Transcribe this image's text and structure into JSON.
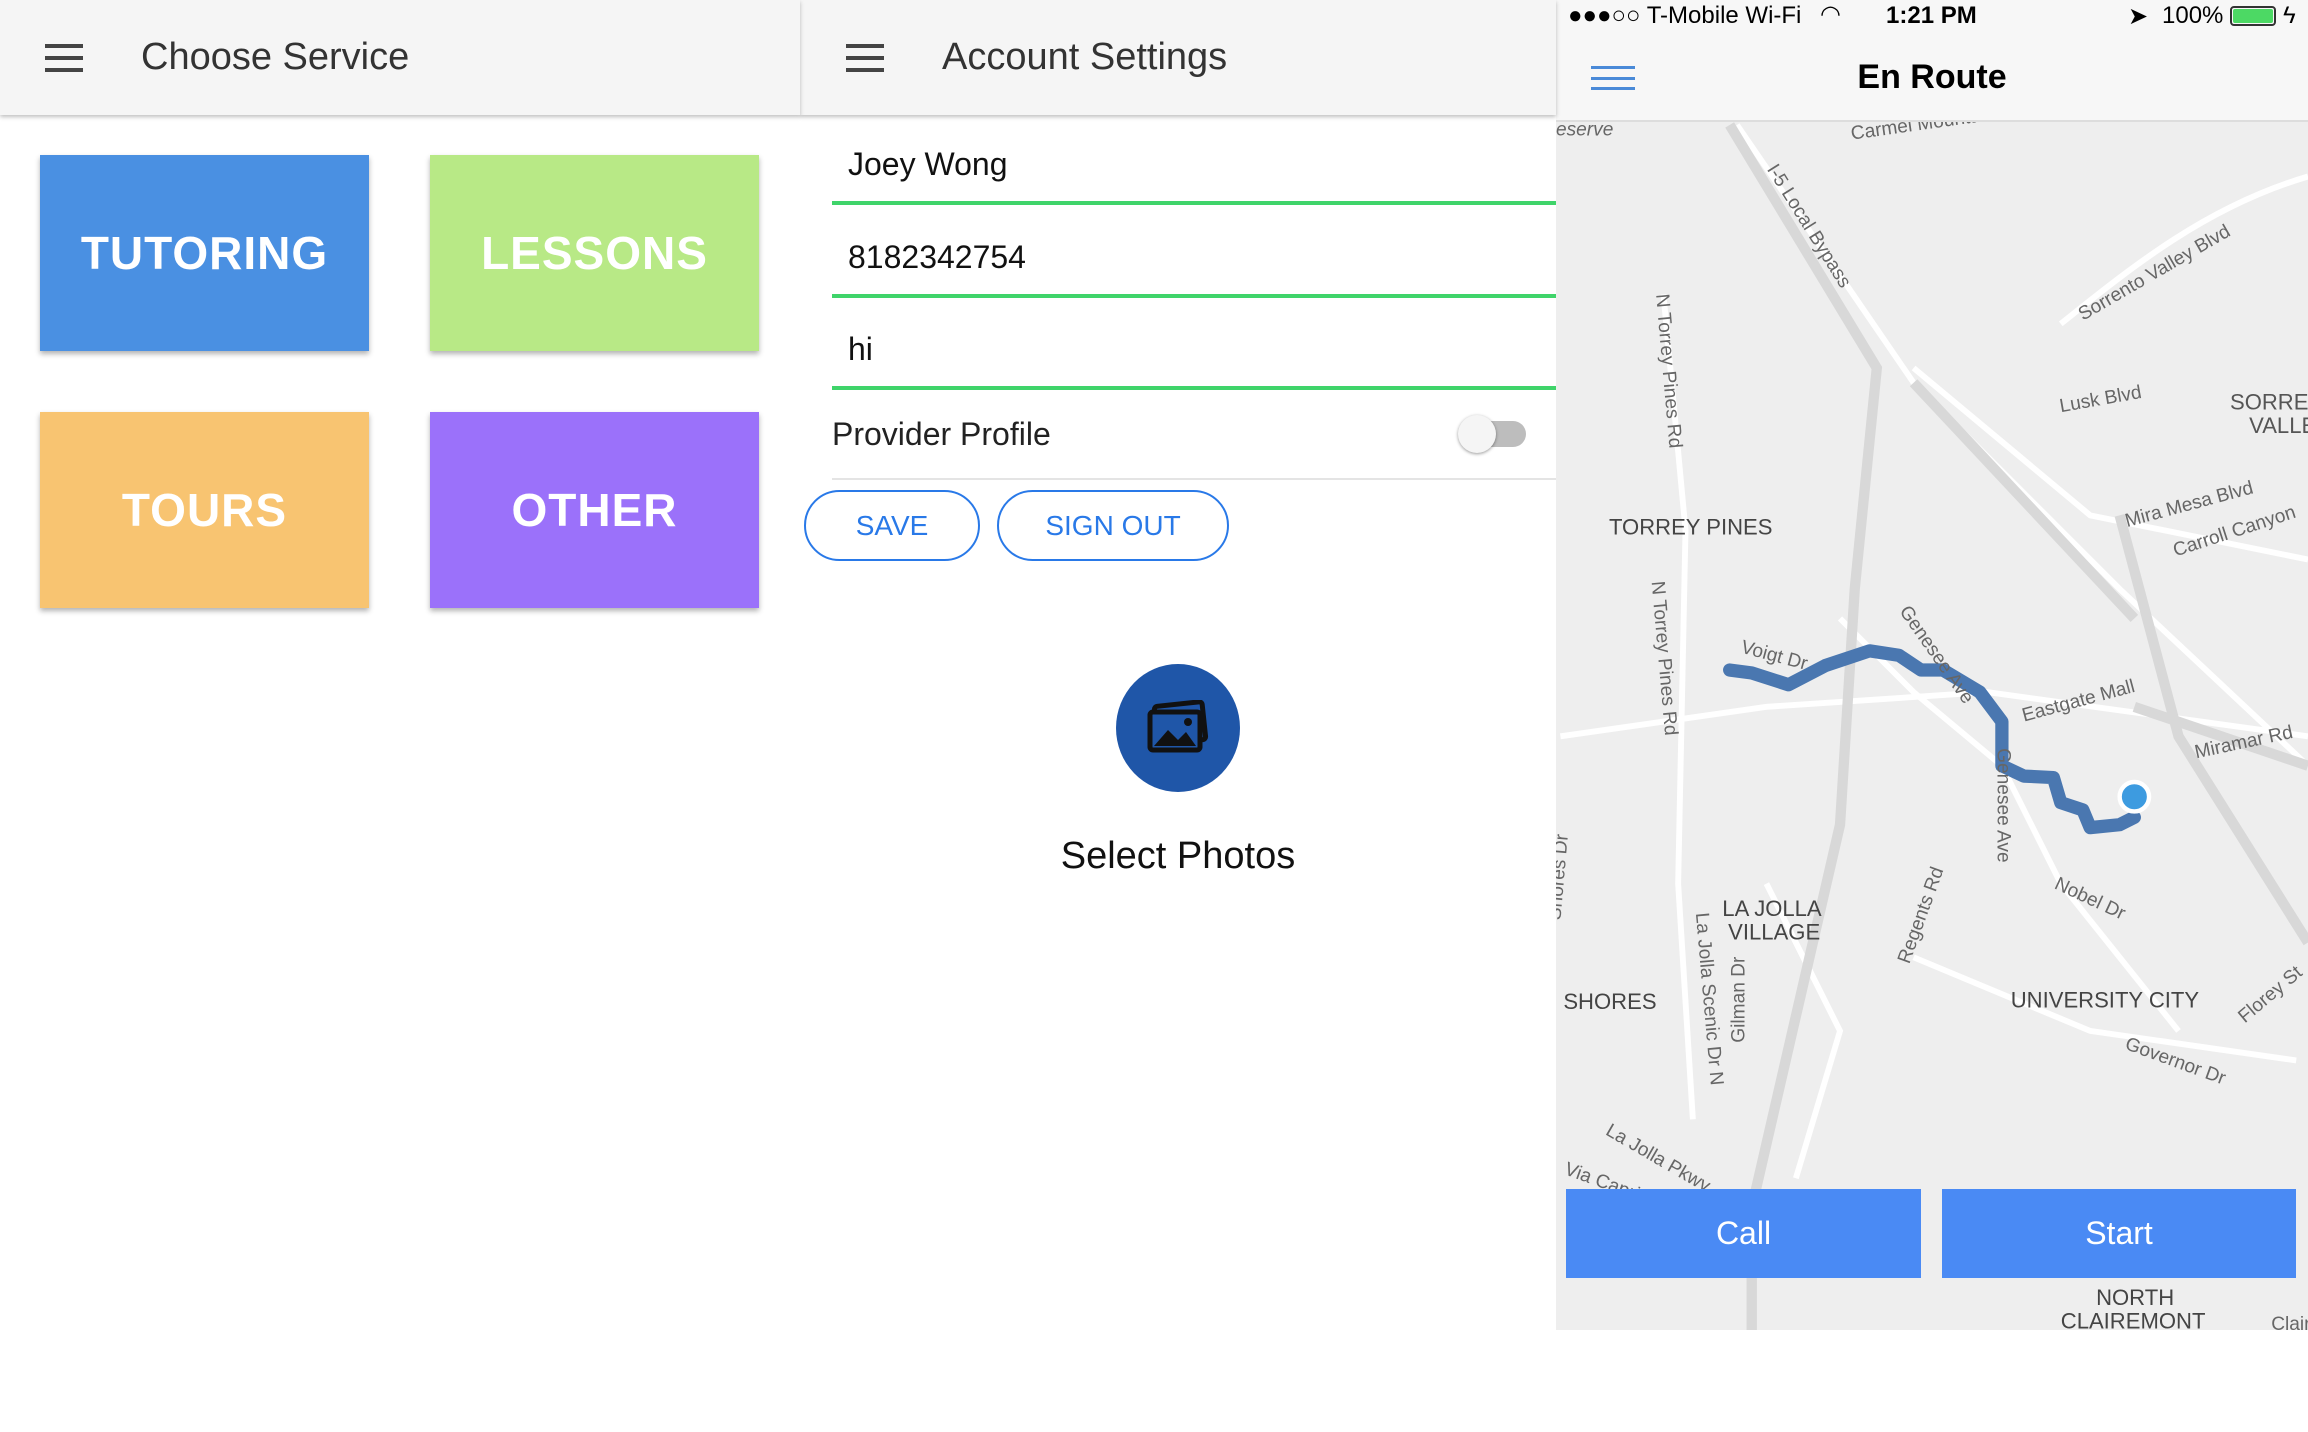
{
  "choose_service": {
    "title": "Choose Service",
    "tiles": [
      {
        "label": "TUTORING",
        "color": "#4a90e2"
      },
      {
        "label": "LESSONS",
        "color": "#b8e986"
      },
      {
        "label": "TOURS",
        "color": "#f8c471"
      },
      {
        "label": "OTHER",
        "color": "#9b71fa"
      }
    ]
  },
  "account": {
    "title": "Account Settings",
    "name": "Joey Wong",
    "phone": "8182342754",
    "bio": "hi",
    "provider_label": "Provider Profile",
    "provider_on": false,
    "save": "SAVE",
    "sign_out": "SIGN OUT",
    "select_photos": "Select Photos"
  },
  "status_bar": {
    "carrier": "●●●○○ T-Mobile Wi-Fi",
    "time": "1:21 PM",
    "battery": "100%"
  },
  "en_route": {
    "title": "En Route",
    "call": "Call",
    "start": "Start",
    "map_labels": [
      "eserve",
      "Carmel Mountain",
      "I-5 Local Bypass",
      "Sorrento Valley Blvd",
      "N Torrey Pines Rd",
      "Lusk Blvd",
      "SORRENTO",
      "VALLEY",
      "TORREY PINES",
      "Mira Mesa Blvd",
      "Carroll Canyon",
      "N Torrey Pines Rd",
      "Voigt Dr",
      "Genesee Ave",
      "Eastgate Mall",
      "Miramar Rd",
      "Genesee Ave",
      "Nobel Dr",
      "Shores Dr",
      "LA JOLLA",
      "VILLAGE",
      "Regents Rd",
      "SHORES",
      "La Jolla Scenic Dr N",
      "Gilman Dr",
      "UNIVERSITY CITY",
      "Florey St",
      "Governor Dr",
      "La Jolla Pkwy",
      "Via Capri",
      "NORTH",
      "CLAIREMONT",
      "Clairemont"
    ]
  }
}
